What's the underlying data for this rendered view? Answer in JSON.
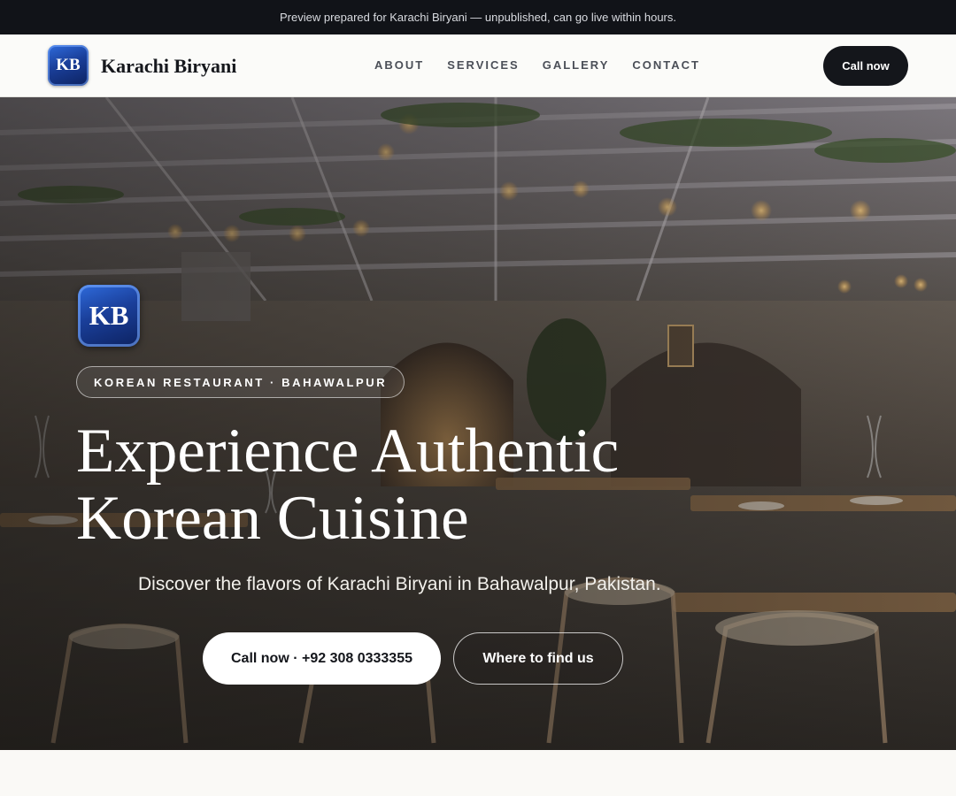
{
  "announcement": "Preview prepared for Karachi Biryani — unpublished, can go live within hours.",
  "brand": {
    "initials": "KB",
    "name": "Karachi Biryani"
  },
  "nav": {
    "items": [
      "ABOUT",
      "SERVICES",
      "GALLERY",
      "CONTACT"
    ]
  },
  "header_cta": "Call now",
  "hero": {
    "badge_initials": "KB",
    "eyebrow": "KOREAN RESTAURANT · BAHAWALPUR",
    "headline_line1": "Experience Authentic",
    "headline_line2": "Korean Cuisine",
    "subtext": "Discover the flavors of Karachi Biryani in Bahawalpur, Pakistan.",
    "primary_cta": "Call now · +92 308 0333355",
    "secondary_cta": "Where to find us"
  },
  "colors": {
    "topbar_bg": "#111318",
    "header_bg": "#fbfbf9",
    "accent_dark": "#14161b",
    "badge_blue": "#1a3f9a",
    "page_bg": "#faf9f6"
  }
}
